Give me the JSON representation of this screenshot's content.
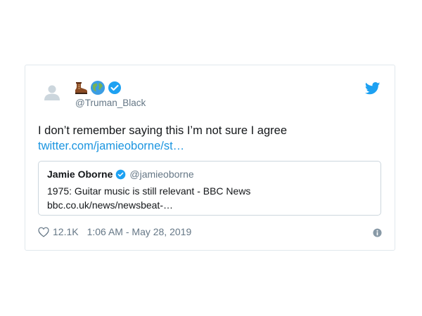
{
  "tweet": {
    "handle": "@Truman_Black",
    "text": "I don’t remember saying this I’m not sure I agree",
    "link": "twitter.com/jamieoborne/st…",
    "emojis": [
      "boot-emoji",
      "globe-emoji",
      "verified-badge-icon"
    ]
  },
  "quoted": {
    "name": "Jamie Oborne",
    "handle": "@jamieoborne",
    "title": "1975: Guitar music is still relevant - BBC News",
    "url": "bbc.co.uk/news/newsbeat-…"
  },
  "footer": {
    "likes": "12.1K",
    "timestamp": "1:06 AM - May 28, 2019"
  },
  "colors": {
    "link": "#1b95e0",
    "secondary_text": "#657786",
    "border": "#e1e8ed",
    "twitter_blue": "#1da1f2"
  }
}
